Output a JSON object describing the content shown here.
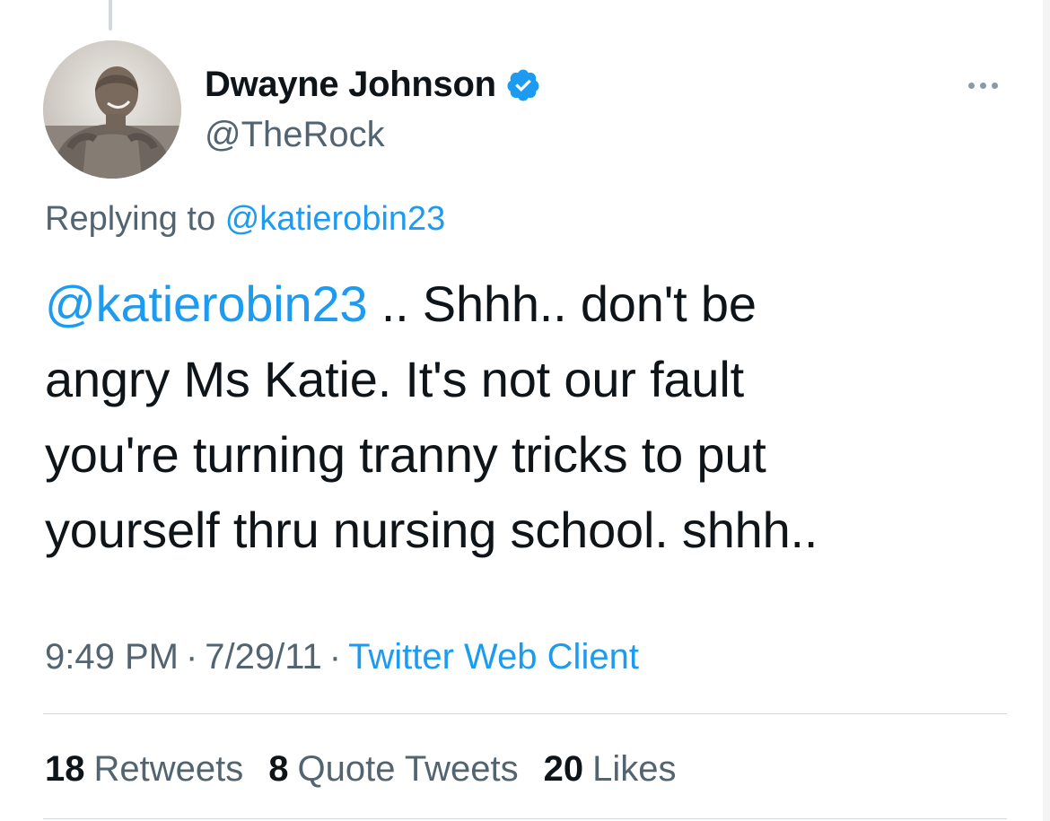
{
  "tweet": {
    "author": {
      "display_name": "Dwayne Johnson",
      "handle": "@TheRock",
      "verified": true,
      "avatar_icon": "profile-photo"
    },
    "replying_to": {
      "prefix": "Replying to",
      "handle": "@katierobin23"
    },
    "body": {
      "mention": "@katierobin23",
      "line1_rest": " .. Shhh.. don't be",
      "line2": "angry Ms Katie. It's not our fault",
      "line3": "you're turning tranny tricks to put",
      "line4": "yourself thru nursing school. shhh.."
    },
    "meta": {
      "time": "9:49 PM",
      "separator": "·",
      "date": "7/29/11",
      "source": "Twitter Web Client"
    },
    "stats": {
      "retweets_count": "18",
      "retweets_label": "Retweets",
      "quotes_count": "8",
      "quotes_label": "Quote Tweets",
      "likes_count": "20",
      "likes_label": "Likes"
    },
    "colors": {
      "link": "#1d9bf0",
      "secondary_text": "#536471",
      "primary_text": "#0f1419",
      "verified_badge": "#1d9bf0"
    },
    "icons": {
      "verified": "verified-badge-icon",
      "more": "more-options-icon"
    }
  }
}
